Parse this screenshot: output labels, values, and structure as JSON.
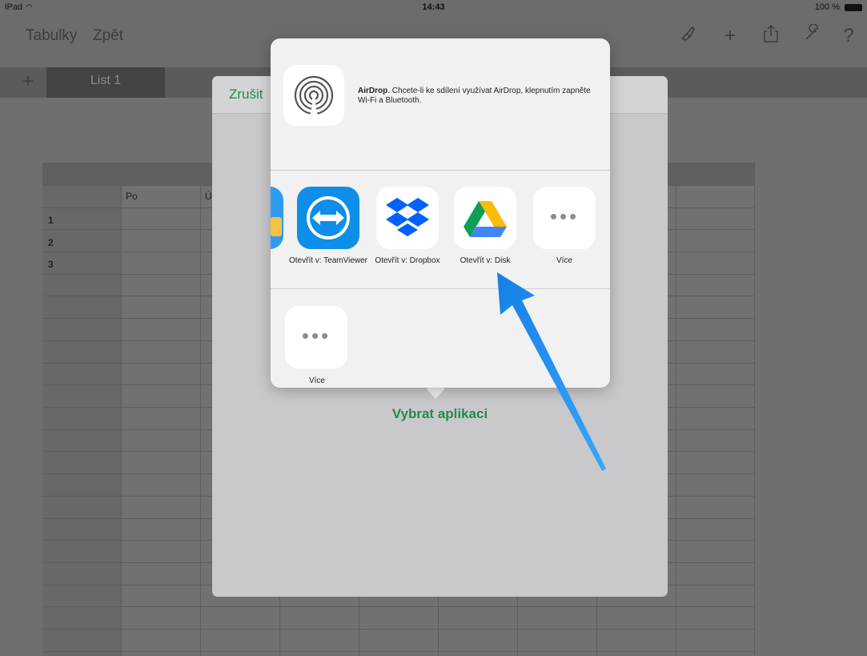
{
  "status_bar": {
    "device": "iPad",
    "wifi": "wifi-icon",
    "time": "14:43",
    "battery": "100 %"
  },
  "toolbar": {
    "tables_label": "Tabulky",
    "back_label": "Zpět",
    "icons": [
      "brush-icon",
      "plus-icon",
      "share-icon",
      "wrench-icon",
      "help-icon"
    ],
    "help_glyph": "?",
    "plus_glyph": "+"
  },
  "sheet_tabs": {
    "add_glyph": "+",
    "active_tab": "List 1"
  },
  "spreadsheet": {
    "column_headers": [
      "Po",
      "Ú"
    ],
    "row_numbers": [
      "1",
      "2",
      "3"
    ]
  },
  "modal": {
    "cancel_label": "Zrušit",
    "choose_app_label": "Vybrat aplikaci"
  },
  "share_sheet": {
    "airdrop_title": "AirDrop",
    "airdrop_text": ". Chcete-li ke sdílení využívat AirDrop, klepnutím zapněte Wi-Fi a Bluetooth.",
    "apps": [
      {
        "label": "Otevřít v: TeamViewer",
        "icon": "teamviewer-icon"
      },
      {
        "label": "Otevřít v: Dropbox",
        "icon": "dropbox-icon"
      },
      {
        "label": "Otevřít v: Disk",
        "icon": "google-drive-icon"
      },
      {
        "label": "Více",
        "icon": "more-icon"
      }
    ],
    "actions": [
      {
        "label": "Více",
        "icon": "more-icon"
      }
    ],
    "more_glyph": "•••"
  },
  "colors": {
    "accent_green": "#1f8c4a",
    "arrow_blue": "#1e88e5",
    "teamviewer_blue": "#0e8ee9",
    "dropbox_blue": "#0061fe"
  }
}
